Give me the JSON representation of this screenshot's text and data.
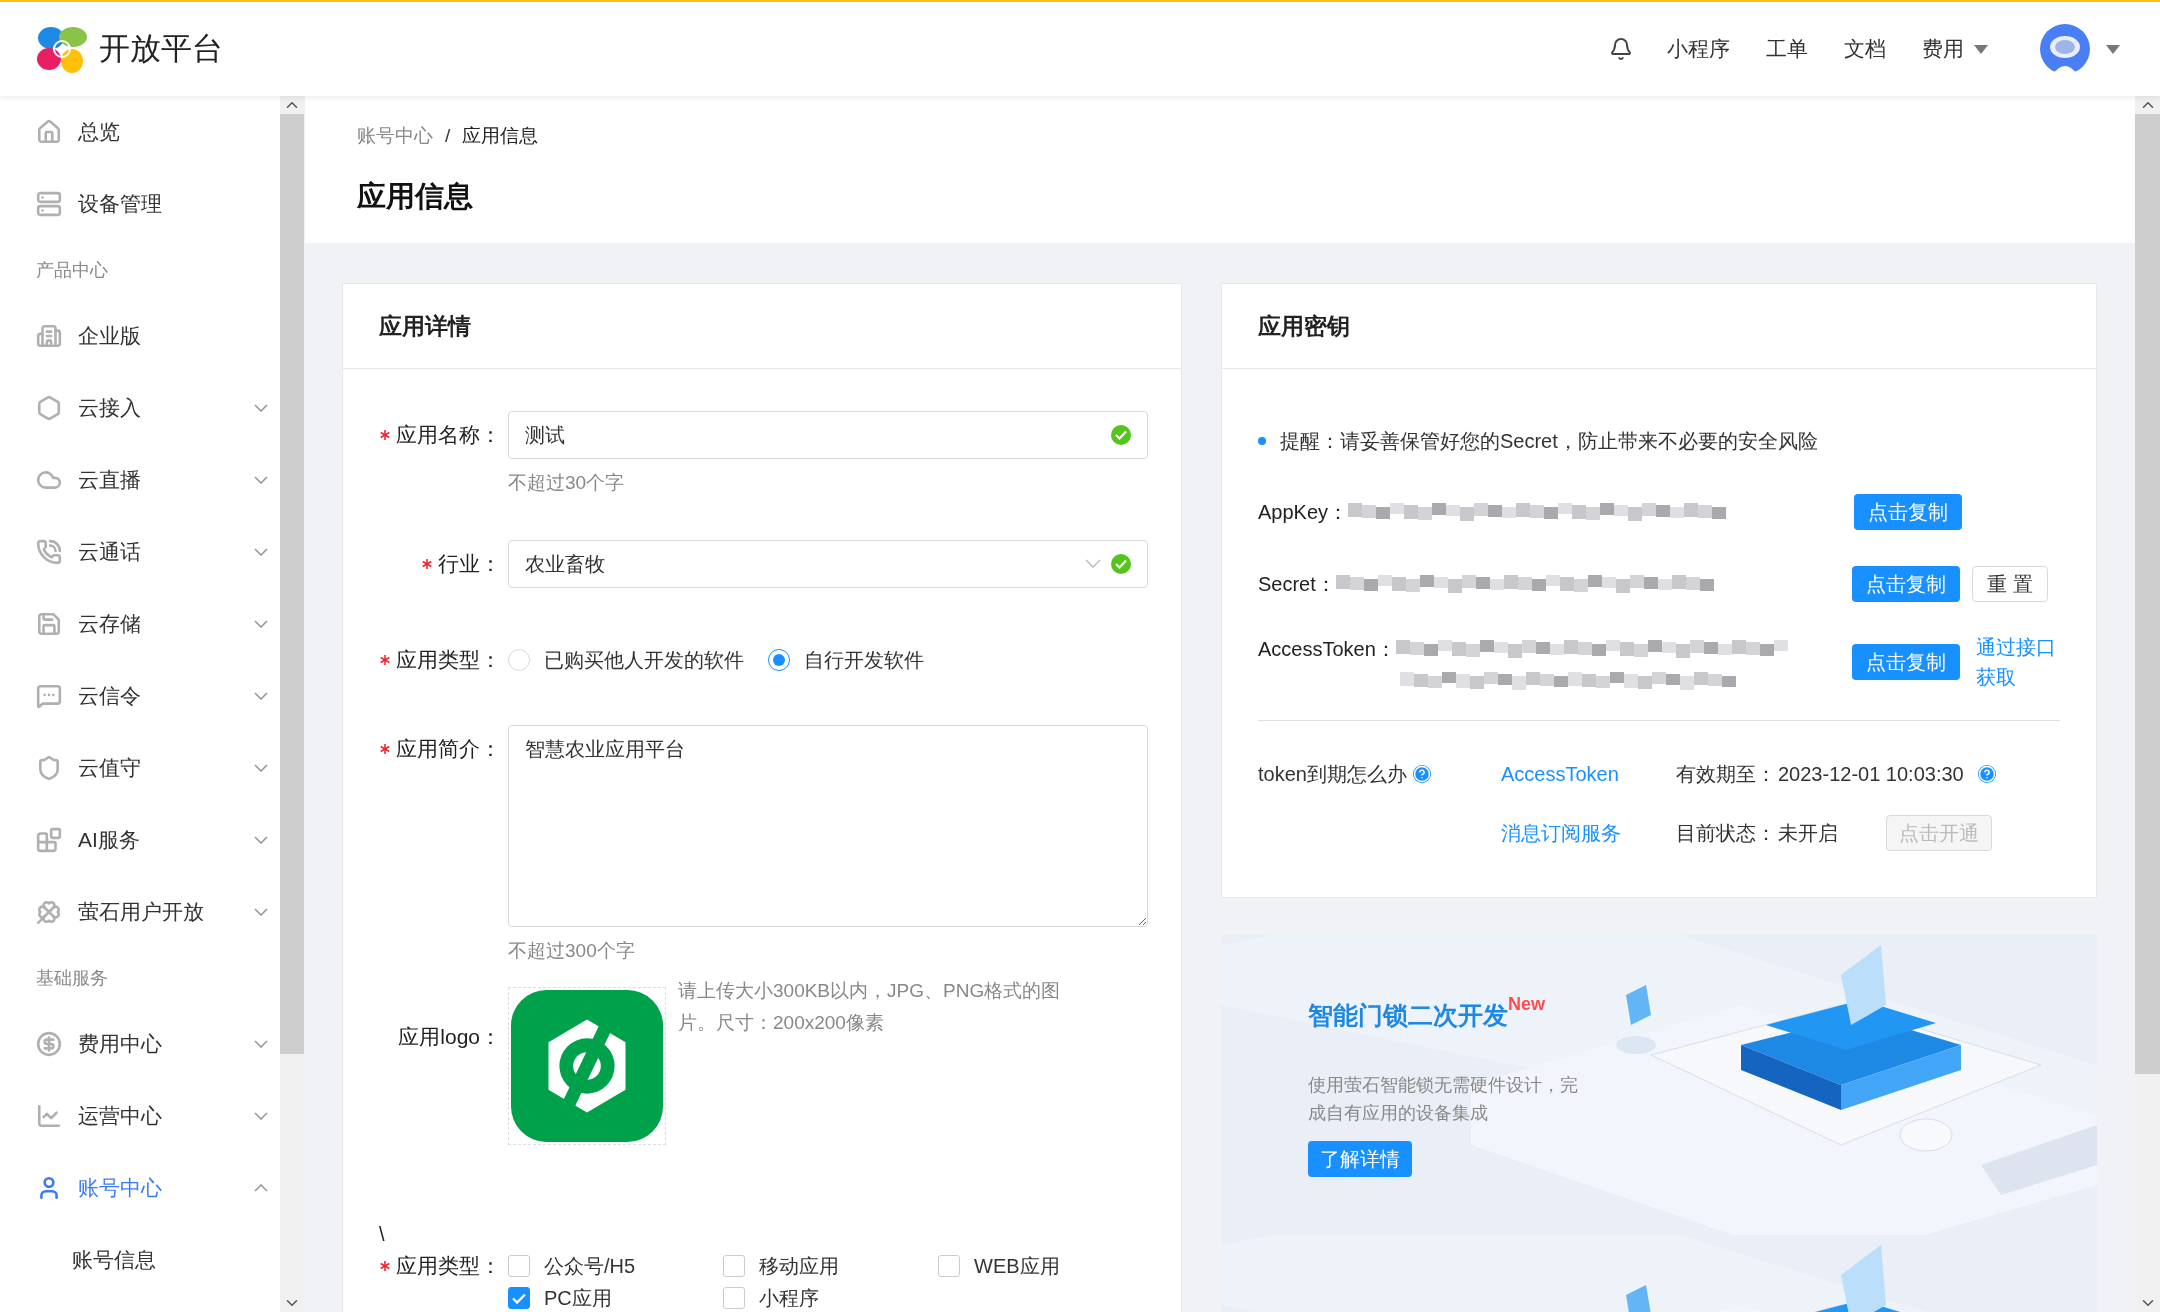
{
  "header": {
    "logo_text": "开放平台",
    "nav": [
      {
        "label": "小程序",
        "has_menu": false
      },
      {
        "label": "工单",
        "has_menu": false
      },
      {
        "label": "文档",
        "has_menu": false
      },
      {
        "label": "费用",
        "has_menu": true
      }
    ]
  },
  "sidebar": {
    "items": [
      {
        "kind": "item",
        "label": "总览",
        "expandable": false,
        "selected": false
      },
      {
        "kind": "item",
        "label": "设备管理",
        "expandable": false,
        "selected": false
      },
      {
        "kind": "section",
        "label": "产品中心"
      },
      {
        "kind": "item",
        "label": "企业版",
        "expandable": false,
        "selected": false
      },
      {
        "kind": "item",
        "label": "云接入",
        "expandable": true,
        "expanded": false,
        "selected": false
      },
      {
        "kind": "item",
        "label": "云直播",
        "expandable": true,
        "expanded": false,
        "selected": false
      },
      {
        "kind": "item",
        "label": "云通话",
        "expandable": true,
        "expanded": false,
        "selected": false
      },
      {
        "kind": "item",
        "label": "云存储",
        "expandable": true,
        "expanded": false,
        "selected": false
      },
      {
        "kind": "item",
        "label": "云信令",
        "expandable": true,
        "expanded": false,
        "selected": false
      },
      {
        "kind": "item",
        "label": "云值守",
        "expandable": true,
        "expanded": false,
        "selected": false
      },
      {
        "kind": "item",
        "label": "AI服务",
        "expandable": true,
        "expanded": false,
        "selected": false
      },
      {
        "kind": "item",
        "label": "萤石用户开放",
        "expandable": true,
        "expanded": false,
        "selected": false
      },
      {
        "kind": "section",
        "label": "基础服务"
      },
      {
        "kind": "item",
        "label": "费用中心",
        "expandable": true,
        "expanded": false,
        "selected": false
      },
      {
        "kind": "item",
        "label": "运营中心",
        "expandable": true,
        "expanded": false,
        "selected": false
      },
      {
        "kind": "item",
        "label": "账号中心",
        "expandable": true,
        "expanded": true,
        "selected": true,
        "children": [
          {
            "label": "账号信息",
            "selected": false
          }
        ]
      }
    ]
  },
  "breadcrumb": {
    "separator": "/",
    "items": [
      {
        "label": "账号中心",
        "current": false
      },
      {
        "label": "应用信息",
        "current": true
      }
    ]
  },
  "page_title": "应用信息",
  "details_card": {
    "title": "应用详情",
    "fields": [
      {
        "kind": "input",
        "label": "应用名称：",
        "required": true,
        "value": "测试",
        "valid": true,
        "hint": "不超过30个字"
      },
      {
        "kind": "select",
        "label": "行业：",
        "required": true,
        "value": "农业畜牧",
        "valid": true
      },
      {
        "kind": "radio",
        "label": "应用类型：",
        "required": true,
        "options": [
          {
            "label": "已购买他人开发的软件",
            "selected": false
          },
          {
            "label": "自行开发软件",
            "selected": true
          }
        ]
      },
      {
        "kind": "textarea",
        "label": "应用简介：",
        "required": true,
        "value": "智慧农业应用平台",
        "hint": "不超过300个字"
      },
      {
        "kind": "logo",
        "label": "应用logo：",
        "required": false,
        "help": "请上传大小300KB以内，JPG、PNG格式的图片。尺寸：200x200像素"
      },
      {
        "kind": "text",
        "text": "\\"
      },
      {
        "kind": "checkbox",
        "label": "应用类型：",
        "required": true,
        "options": [
          {
            "label": "公众号/H5",
            "checked": false
          },
          {
            "label": "移动应用",
            "checked": false
          },
          {
            "label": "WEB应用",
            "checked": false
          },
          {
            "label": "PC应用",
            "checked": true
          },
          {
            "label": "小程序",
            "checked": false
          }
        ]
      }
    ]
  },
  "key_card": {
    "title": "应用密钥",
    "notice": "提醒：请妥善保管好您的Secret，防止带来不必要的安全风险",
    "keys": [
      {
        "label": "AppKey：",
        "kind": "short",
        "buttons": [
          {
            "label": "点击复制",
            "kind": "primary"
          }
        ]
      },
      {
        "label": "Secret：",
        "kind": "short",
        "buttons": [
          {
            "label": "点击复制",
            "kind": "primary"
          },
          {
            "label": "重 置",
            "kind": "outline"
          }
        ]
      },
      {
        "label": "AccessToken：",
        "kind": "long",
        "buttons": [
          {
            "label": "点击复制",
            "kind": "primary"
          }
        ],
        "link": "通过接口获取"
      }
    ],
    "token_help": "token到期怎么办",
    "services": [
      {
        "link": "AccessToken",
        "label": "有效期至：",
        "value": "2023-12-01 10:03:30",
        "help": true
      },
      {
        "link": "消息订阅服务",
        "label": "目前状态：",
        "value": "未开启",
        "help": false,
        "button": {
          "label": "点击开通",
          "disabled": true
        }
      }
    ]
  },
  "banner": {
    "title": "智能门锁二次开发",
    "badge": "New",
    "description": "使用萤石智能锁无需硬件设计，完成自有应用的设备集成",
    "button": "了解详情"
  }
}
